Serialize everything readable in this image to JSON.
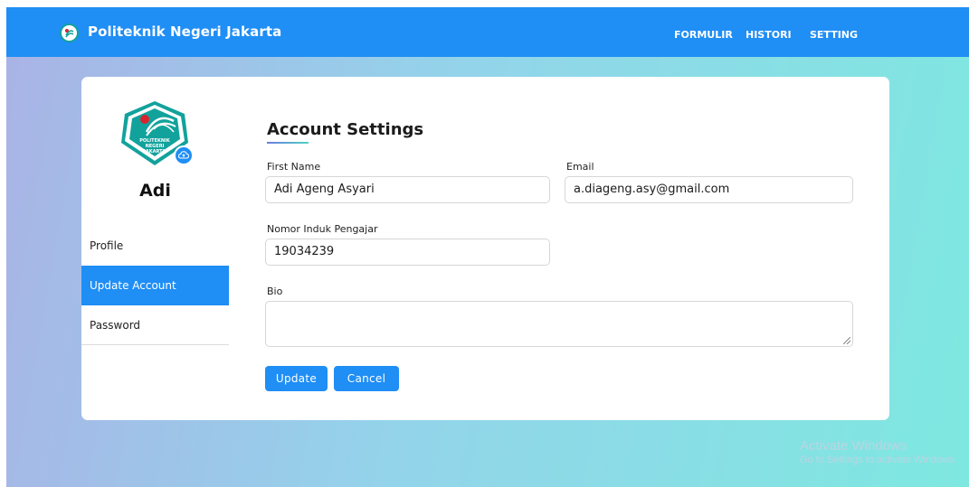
{
  "brand": {
    "title": "Politeknik Negeri Jakarta",
    "logo_icon": "pnj-logo-icon"
  },
  "nav": {
    "links": [
      "FORMULIR",
      "HISTORI",
      "SETTING"
    ]
  },
  "profile": {
    "name": "Adi",
    "upload_icon": "cloud-upload-icon",
    "logo_text": [
      "POLITEKNIK",
      "NEGERI",
      "JAKARTA"
    ]
  },
  "sidebar": {
    "items": [
      {
        "label": "Profile",
        "active": false
      },
      {
        "label": "Update Account",
        "active": true
      },
      {
        "label": "Password",
        "active": false
      }
    ]
  },
  "form": {
    "title": "Account Settings",
    "first_name": {
      "label": "First Name",
      "value": "Adi Ageng Asyari"
    },
    "email": {
      "label": "Email",
      "value": "a.diageng.asy@gmail.com"
    },
    "nip": {
      "label": "Nomor Induk Pengajar",
      "value": "19034239"
    },
    "bio": {
      "label": "Bio",
      "value": ""
    },
    "update_label": "Update",
    "cancel_label": "Cancel"
  },
  "watermark": {
    "line1": "Activate Windows",
    "line2": "Go to Settings to activate Windows."
  },
  "colors": {
    "primary": "#1f8ef5",
    "teal": "#12a29c",
    "accent_red": "#d9232d"
  }
}
